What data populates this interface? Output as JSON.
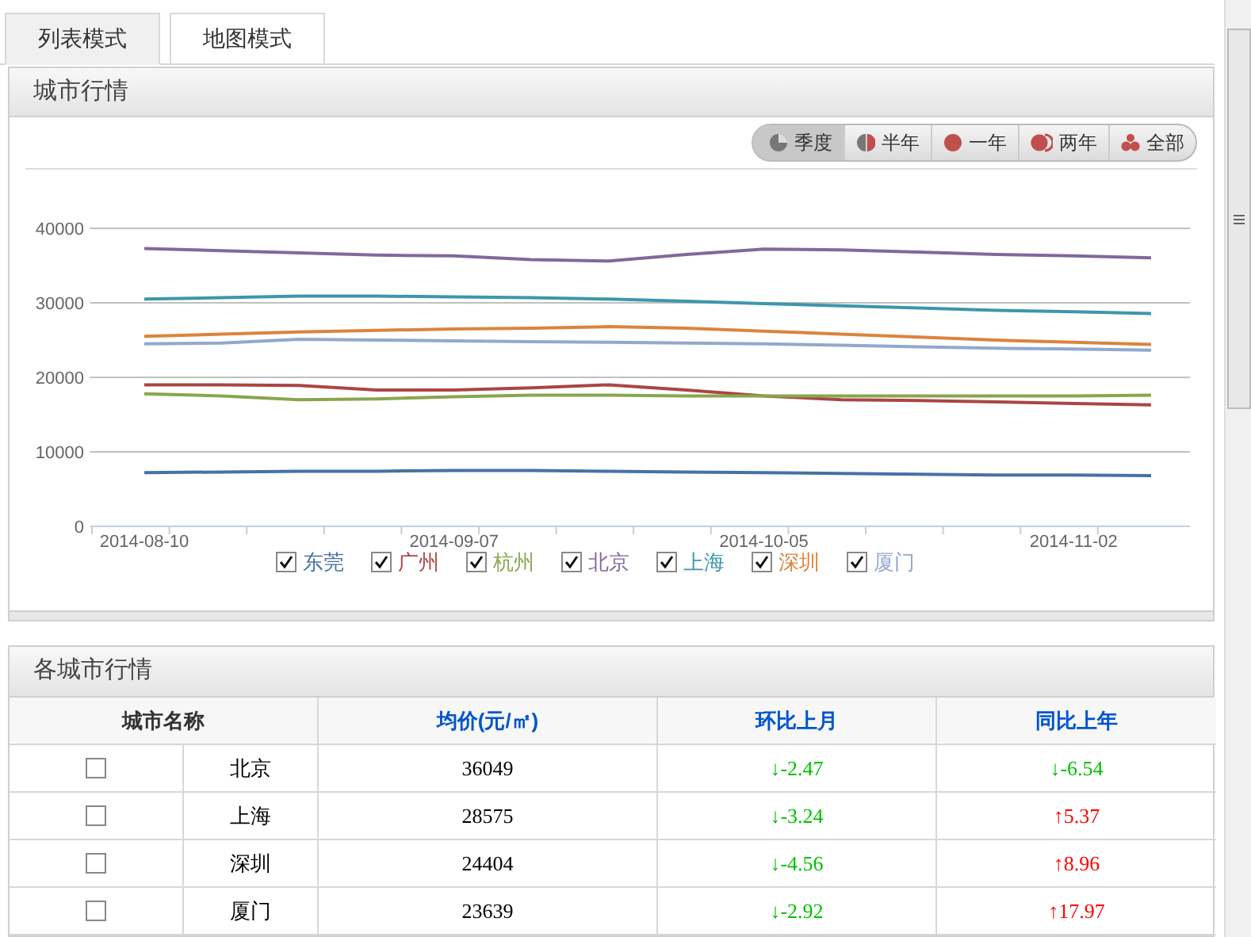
{
  "tabs": [
    {
      "label": "列表模式",
      "selected": true
    },
    {
      "label": "地图模式",
      "selected": false
    }
  ],
  "city_panel": {
    "title": "城市行情",
    "ranges": [
      {
        "label": "季度",
        "selected": true
      },
      {
        "label": "半年",
        "selected": false
      },
      {
        "label": "一年",
        "selected": false
      },
      {
        "label": "两年",
        "selected": false
      },
      {
        "label": "全部",
        "selected": false
      }
    ],
    "chart_data": {
      "type": "line",
      "grid": true,
      "categories": [
        "2014-08-10",
        null,
        null,
        null,
        "2014-09-07",
        null,
        null,
        null,
        "2014-10-05",
        null,
        null,
        null,
        "2014-11-02",
        null
      ],
      "ylim": [
        0,
        40000
      ],
      "yticks": [
        0,
        10000,
        20000,
        30000,
        40000
      ],
      "series": [
        {
          "name": "东莞",
          "color": "#4572a7",
          "values": [
            7200,
            7300,
            7400,
            7400,
            7500,
            7500,
            7400,
            7300,
            7200,
            7100,
            7000,
            6900,
            6900,
            6800
          ]
        },
        {
          "name": "广州",
          "color": "#aa4643",
          "values": [
            19000,
            19000,
            18900,
            18300,
            18300,
            18600,
            19000,
            18300,
            17500,
            17000,
            16900,
            16700,
            16500,
            16300
          ]
        },
        {
          "name": "杭州",
          "color": "#89a54e",
          "values": [
            17800,
            17500,
            17000,
            17100,
            17400,
            17600,
            17600,
            17500,
            17500,
            17500,
            17500,
            17500,
            17500,
            17600
          ]
        },
        {
          "name": "北京",
          "color": "#80699b",
          "values": [
            37300,
            37000,
            36700,
            36400,
            36300,
            35800,
            35600,
            36500,
            37200,
            37100,
            36800,
            36500,
            36300,
            36049
          ]
        },
        {
          "name": "上海",
          "color": "#3d96ae",
          "values": [
            30500,
            30700,
            30900,
            30900,
            30800,
            30700,
            30500,
            30200,
            29900,
            29600,
            29300,
            29000,
            28800,
            28575
          ]
        },
        {
          "name": "深圳",
          "color": "#db843d",
          "values": [
            25500,
            25800,
            26100,
            26300,
            26500,
            26600,
            26800,
            26600,
            26200,
            25800,
            25400,
            25000,
            24700,
            24404
          ]
        },
        {
          "name": "厦门",
          "color": "#92a8cd",
          "values": [
            24500,
            24600,
            25100,
            25000,
            24900,
            24800,
            24700,
            24600,
            24500,
            24300,
            24100,
            23900,
            23800,
            23639
          ]
        }
      ]
    },
    "legend": [
      {
        "checked": true
      },
      {
        "checked": true
      },
      {
        "checked": true
      },
      {
        "checked": true
      },
      {
        "checked": true
      },
      {
        "checked": true
      },
      {
        "checked": true
      }
    ]
  },
  "table_panel": {
    "title": "各城市行情",
    "columns": [
      "城市名称",
      "均价(元/㎡)",
      "环比上月",
      "同比上年"
    ],
    "rows": [
      {
        "checked": false,
        "city": "北京",
        "price": "36049",
        "mom": "↓-2.47",
        "mom_rising": false,
        "yoy": "↓-6.54",
        "yoy_rising": false
      },
      {
        "checked": false,
        "city": "上海",
        "price": "28575",
        "mom": "↓-3.24",
        "mom_rising": false,
        "yoy": "↑5.37",
        "yoy_rising": true
      },
      {
        "checked": false,
        "city": "深圳",
        "price": "24404",
        "mom": "↓-4.56",
        "mom_rising": false,
        "yoy": "↑8.96",
        "yoy_rising": true
      },
      {
        "checked": false,
        "city": "厦门",
        "price": "23639",
        "mom": "↓-2.92",
        "mom_rising": false,
        "yoy": "↑17.97",
        "yoy_rising": true
      }
    ]
  }
}
